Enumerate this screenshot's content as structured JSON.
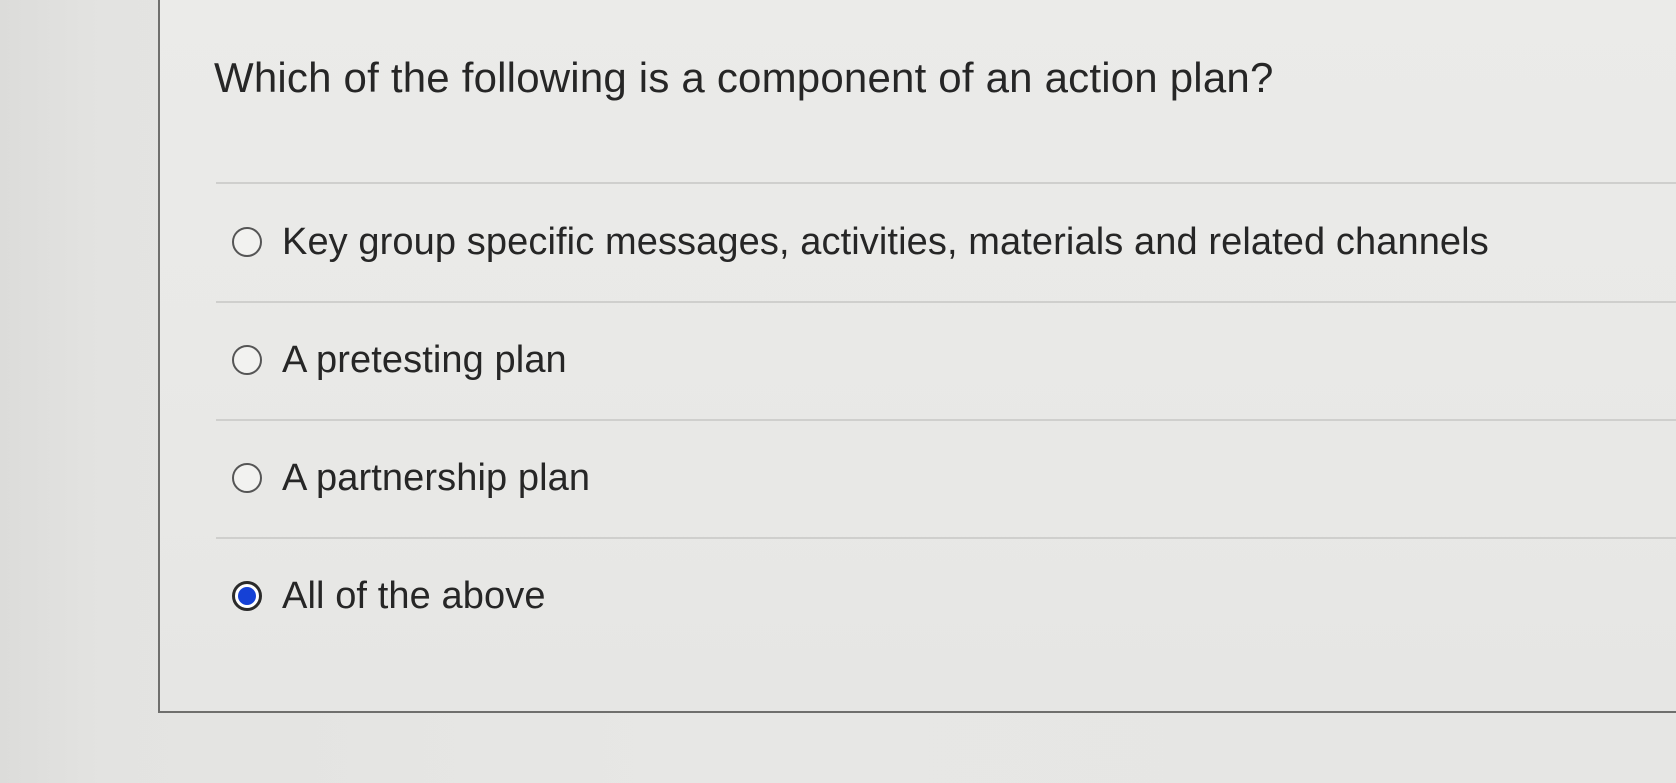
{
  "question": {
    "text": "Which of the following is a component of an action plan?"
  },
  "options": [
    {
      "label": "Key group specific messages, activities, materials and related channels",
      "selected": false
    },
    {
      "label": "A pretesting plan",
      "selected": false
    },
    {
      "label": "A partnership plan",
      "selected": false
    },
    {
      "label": "All of the above",
      "selected": true
    }
  ],
  "colors": {
    "selected_radio": "#1541d6",
    "text": "#262626",
    "background": "#e9e9e7"
  },
  "icons": {
    "unselected": "radio-unchecked-icon",
    "selected": "radio-checked-icon"
  }
}
